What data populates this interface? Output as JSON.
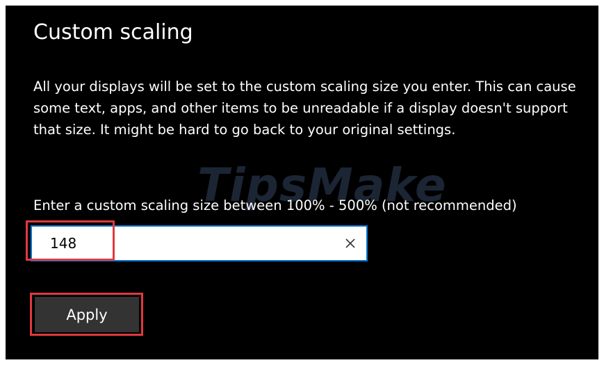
{
  "dialog": {
    "title": "Custom scaling",
    "description": "All your displays will be set to the custom scaling size you enter. This can cause some text, apps, and other items to be unreadable if a display doesn't support that size. It might be hard to go back to your original settings.",
    "hint": "Enter a custom scaling size between 100% - 500% (not recommended)",
    "input_value": "148",
    "apply_label": "Apply"
  },
  "watermark": "TipsMake",
  "icons": {
    "clear": "close-icon"
  },
  "colors": {
    "background": "#000000",
    "accent": "#0078d7",
    "highlight": "#e0393e",
    "button": "#333333"
  }
}
